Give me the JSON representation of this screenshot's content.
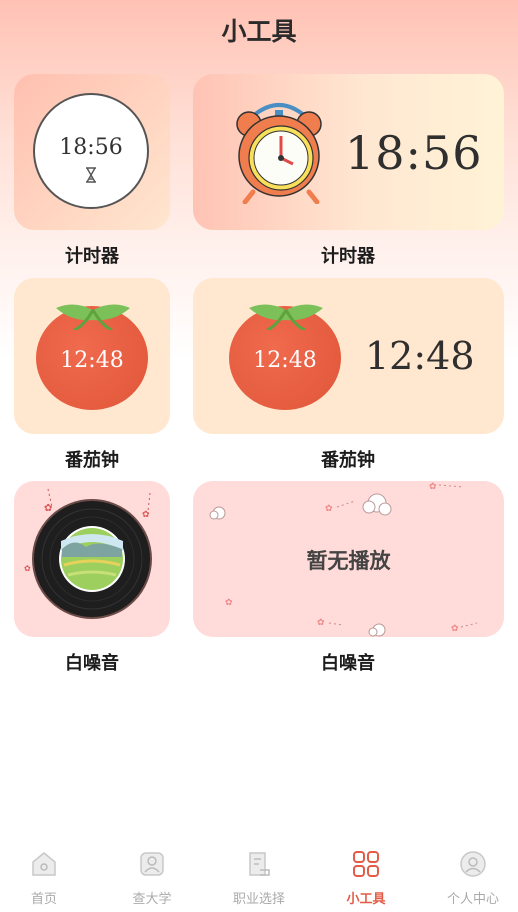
{
  "header": {
    "title": "小工具"
  },
  "timer": {
    "small_time": "18:56",
    "large_time": "18:56",
    "label_small": "计时器",
    "label_large": "计时器"
  },
  "tomato": {
    "small_time": "12:48",
    "large_time": "12:48",
    "label_small": "番茄钟",
    "label_large": "番茄钟"
  },
  "noise": {
    "status": "暂无播放",
    "label_small": "白噪音",
    "label_large": "白噪音"
  },
  "tabbar": {
    "items": [
      {
        "label": "首页",
        "icon": "home-icon"
      },
      {
        "label": "查大学",
        "icon": "university-icon"
      },
      {
        "label": "职业选择",
        "icon": "career-icon"
      },
      {
        "label": "小工具",
        "icon": "tools-grid-icon"
      },
      {
        "label": "个人中心",
        "icon": "profile-icon"
      }
    ],
    "active_index": 3
  },
  "colors": {
    "accent": "#e25c48",
    "tomato": "#e55c3f",
    "leaf": "#7cc05a"
  }
}
